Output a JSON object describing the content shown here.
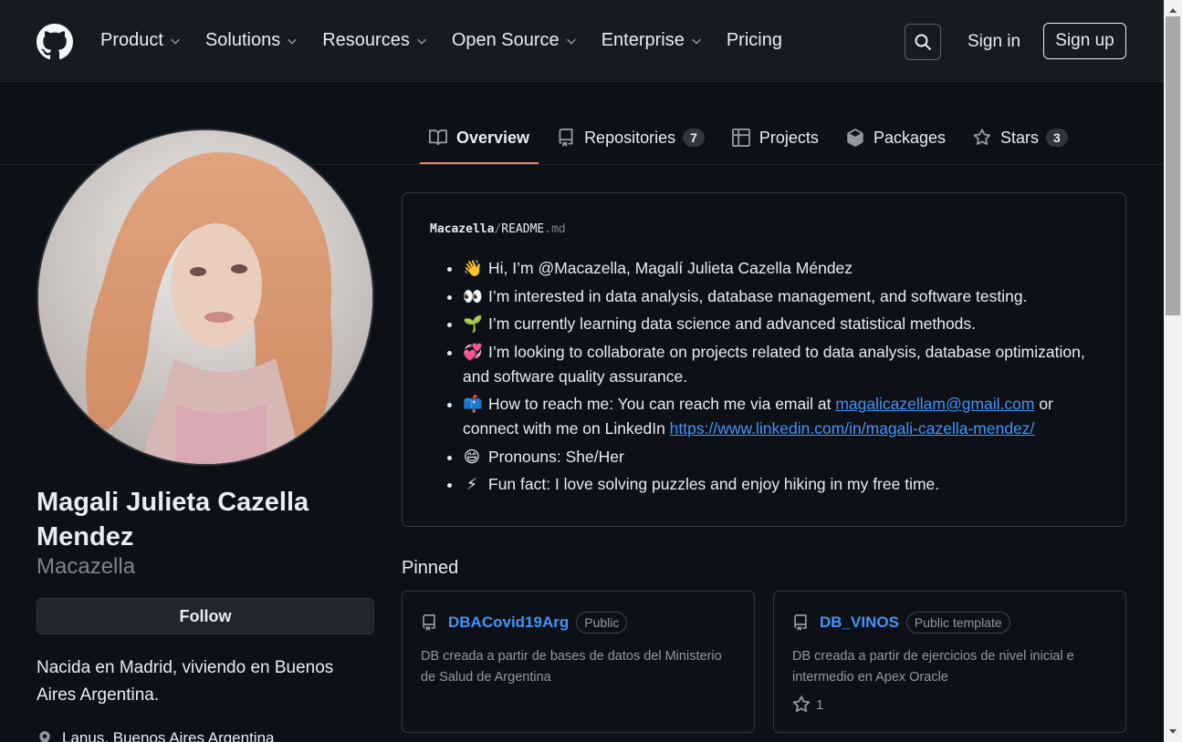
{
  "header": {
    "nav": [
      {
        "label": "Product",
        "dropdown": true
      },
      {
        "label": "Solutions",
        "dropdown": true
      },
      {
        "label": "Resources",
        "dropdown": true
      },
      {
        "label": "Open Source",
        "dropdown": true
      },
      {
        "label": "Enterprise",
        "dropdown": true
      },
      {
        "label": "Pricing",
        "dropdown": false
      }
    ],
    "signin": "Sign in",
    "signup": "Sign up"
  },
  "tabs": [
    {
      "label": "Overview",
      "icon": "book-icon",
      "active": true,
      "count": ""
    },
    {
      "label": "Repositories",
      "icon": "repo-icon",
      "active": false,
      "count": "7"
    },
    {
      "label": "Projects",
      "icon": "table-icon",
      "active": false,
      "count": ""
    },
    {
      "label": "Packages",
      "icon": "package-icon",
      "active": false,
      "count": ""
    },
    {
      "label": "Stars",
      "icon": "star-icon",
      "active": false,
      "count": "3"
    }
  ],
  "profile": {
    "fullname": "Magali Julieta Cazella Mendez",
    "username": "Macazella",
    "follow": "Follow",
    "bio": "Nacida en Madrid, viviendo en Buenos Aires Argentina.",
    "location": "Lanus, Buenos Aires Argentina"
  },
  "readme": {
    "owner": "Macazella",
    "sep": "/",
    "file": "README",
    "ext": ".md",
    "items": [
      {
        "emoji": "👋",
        "text": "Hi, I’m @Macazella, Magalí Julieta Cazella Méndez"
      },
      {
        "emoji": "👀",
        "text": "I’m interested in data analysis, database management, and software testing."
      },
      {
        "emoji": "🌱",
        "text": "I’m currently learning data science and advanced statistical methods."
      },
      {
        "emoji": "💞",
        "text": "I’m looking to collaborate on projects related to data analysis, database optimization, and software quality assurance."
      },
      {
        "emoji": "📫",
        "text_before": "How to reach me: You can reach me via email at ",
        "email": "magalicazellam@gmail.com",
        "text_mid": " or connect with me on LinkedIn ",
        "link": "https://www.linkedin.com/in/magali-cazella-mendez/"
      },
      {
        "emoji": "😄",
        "text": "Pronouns: She/Her"
      },
      {
        "emoji": "⚡",
        "text": "Fun fact: I love solving puzzles and enjoy hiking in my free time."
      }
    ]
  },
  "pinned": {
    "title": "Pinned",
    "cards": [
      {
        "name": "DBACovid19Arg",
        "badge": "Public",
        "desc": "DB creada a partir de bases de datos del Ministerio de Salud de Argentina",
        "stars": ""
      },
      {
        "name": "DB_VINOS",
        "badge": "Public template",
        "desc": "DB creada a partir de ejercicios de nivel inicial e intermedio en Apex Oracle",
        "stars": "1"
      }
    ]
  },
  "colors": {
    "bg": "#0d1117",
    "header": "#161b22",
    "accent": "#f78166",
    "link": "#4493f8"
  }
}
